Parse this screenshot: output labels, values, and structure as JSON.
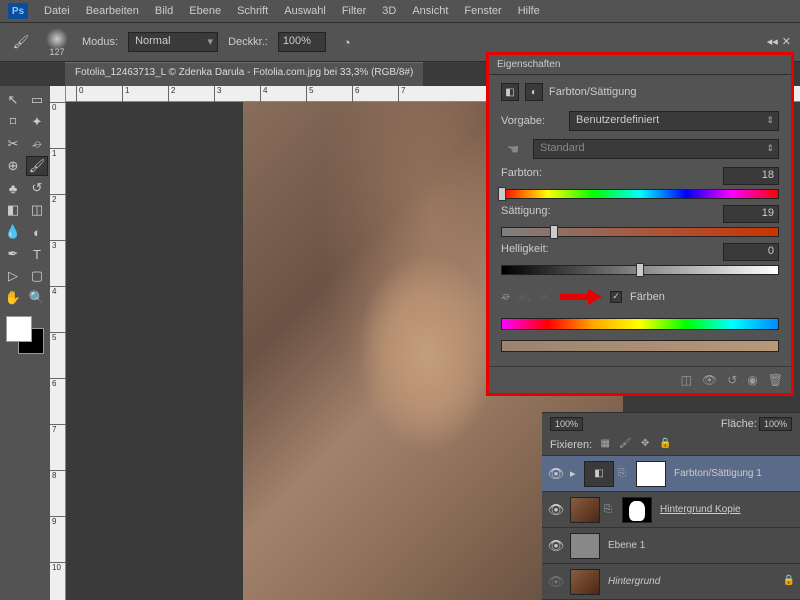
{
  "menu": {
    "items": [
      "Datei",
      "Bearbeiten",
      "Bild",
      "Ebene",
      "Schrift",
      "Auswahl",
      "Filter",
      "3D",
      "Ansicht",
      "Fenster",
      "Hilfe"
    ]
  },
  "optbar": {
    "brush_size": "127",
    "mode_label": "Modus:",
    "mode_value": "Normal",
    "opacity_label": "Deckkr.:",
    "opacity_value": "100%"
  },
  "doc": {
    "title": "Fotolia_12463713_L © Zdenka Darula - Fotolia.com.jpg bei 33,3% (RGB/8#)"
  },
  "props": {
    "tab": "Eigenschaften",
    "title": "Farbton/Sättigung",
    "preset_label": "Vorgabe:",
    "preset_value": "Benutzerdefiniert",
    "range_value": "Standard",
    "hue_label": "Farbton:",
    "hue_value": "18",
    "hue_pos": "5%",
    "sat_label": "Sättigung:",
    "sat_value": "19",
    "sat_pos": "19%",
    "light_label": "Helligkeit:",
    "light_value": "0",
    "light_pos": "50%",
    "colorize_label": "Färben",
    "colorize_checked": "✓"
  },
  "layers": {
    "opacity_label": "100%",
    "fill_label": "Fläche:",
    "fill_value": "100%",
    "lock_label": "Fixieren:",
    "items": [
      {
        "name": "Farbton/Sättigung 1"
      },
      {
        "name": "Hintergrund Kopie"
      },
      {
        "name": "Ebene 1"
      },
      {
        "name": "Hintergrund"
      }
    ]
  },
  "ruler": {
    "h": [
      "0",
      "1",
      "2",
      "3",
      "4",
      "5",
      "6",
      "7"
    ],
    "v": [
      "0",
      "1",
      "2",
      "3",
      "4",
      "5",
      "6",
      "7",
      "8",
      "9",
      "10"
    ]
  }
}
